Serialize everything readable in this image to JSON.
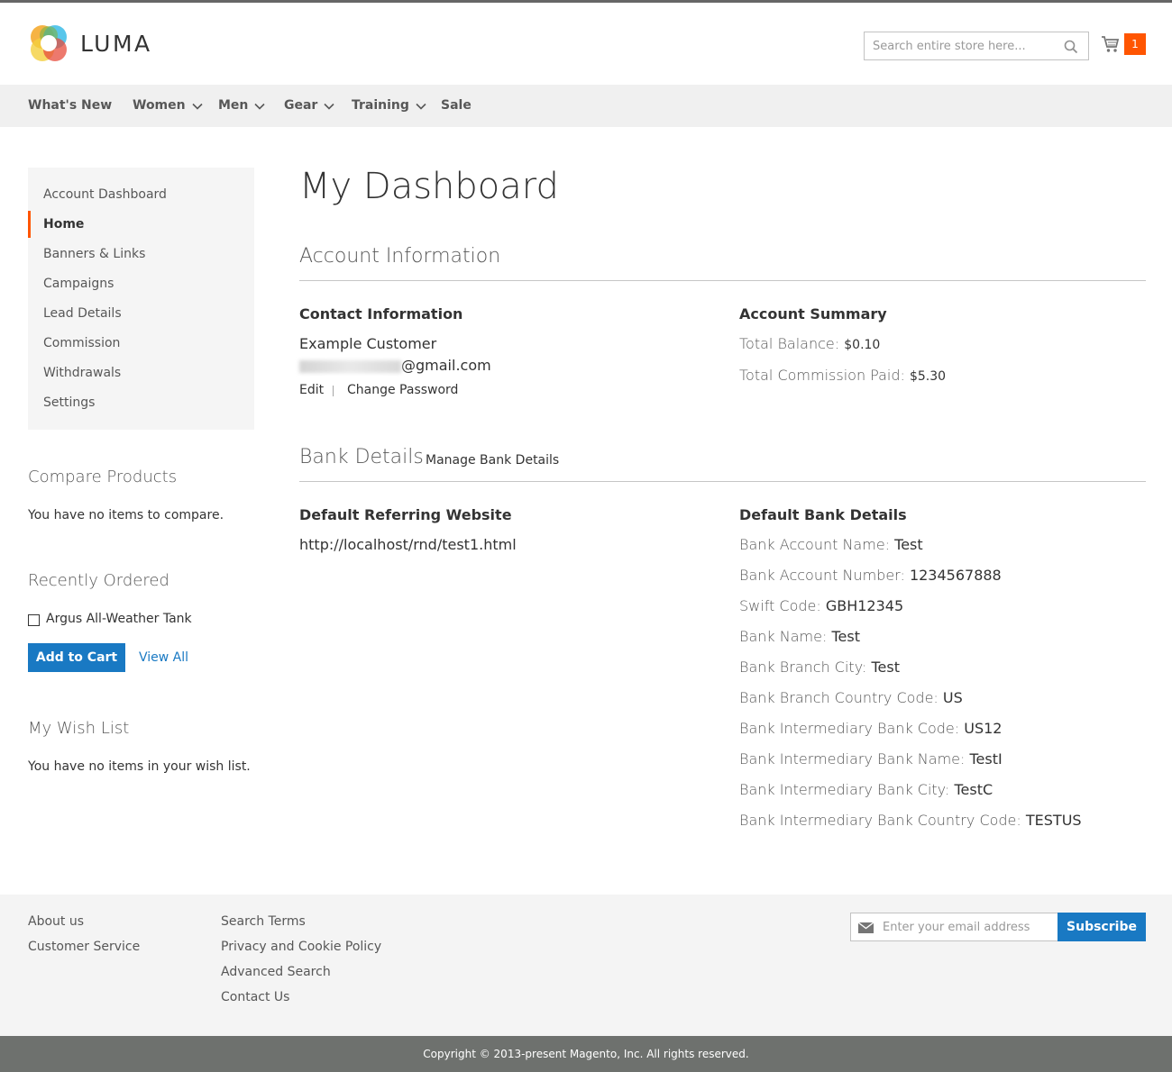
{
  "header": {
    "logo_text": "LUMA",
    "search_placeholder": "Search entire store here...",
    "cart_count": "1"
  },
  "nav": {
    "items": [
      {
        "label": "What's New",
        "dropdown": false
      },
      {
        "label": "Women",
        "dropdown": true
      },
      {
        "label": "Men",
        "dropdown": true
      },
      {
        "label": "Gear",
        "dropdown": true
      },
      {
        "label": "Training",
        "dropdown": true
      },
      {
        "label": "Sale",
        "dropdown": false
      }
    ]
  },
  "sidebar": {
    "items": [
      {
        "label": "Account Dashboard",
        "active": false
      },
      {
        "label": "Home",
        "active": true
      },
      {
        "label": "Banners & Links",
        "active": false
      },
      {
        "label": "Campaigns",
        "active": false
      },
      {
        "label": "Lead Details",
        "active": false
      },
      {
        "label": "Commission",
        "active": false
      },
      {
        "label": "Withdrawals",
        "active": false
      },
      {
        "label": "Settings",
        "active": false
      }
    ],
    "compare": {
      "title": "Compare Products",
      "empty_text": "You have no items to compare."
    },
    "recently_ordered": {
      "title": "Recently Ordered",
      "item": "Argus All-Weather Tank",
      "add_to_cart": "Add to Cart",
      "view_all": "View All"
    },
    "wishlist": {
      "title": "My Wish List",
      "empty_text": "You have no items in your wish list."
    }
  },
  "main": {
    "page_title": "My Dashboard",
    "account_info": {
      "title": "Account Information",
      "contact": {
        "title": "Contact Information",
        "name": "Example Customer",
        "email_suffix": "@gmail.com",
        "edit": "Edit",
        "change_password": "Change Password"
      },
      "summary": {
        "title": "Account Summary",
        "total_balance_label": "Total Balance:",
        "total_balance_value": "$0.10",
        "commission_paid_label": "Total Commission Paid:",
        "commission_paid_value": "$5.30"
      }
    },
    "bank": {
      "title": "Bank Details",
      "manage_link": "Manage Bank Details",
      "referring_title": "Default Referring Website",
      "referring_url": "http://localhost/rnd/test1.html",
      "details_title": "Default Bank Details",
      "fields": [
        {
          "label": "Bank Account Name:",
          "value": "Test"
        },
        {
          "label": "Bank Account Number:",
          "value": "1234567888"
        },
        {
          "label": "Swift Code:",
          "value": "GBH12345"
        },
        {
          "label": "Bank Name:",
          "value": "Test"
        },
        {
          "label": "Bank Branch City:",
          "value": "Test"
        },
        {
          "label": "Bank Branch Country Code:",
          "value": "US"
        },
        {
          "label": "Bank Intermediary Bank Code:",
          "value": "US12"
        },
        {
          "label": "Bank Intermediary Bank Name:",
          "value": "TestI"
        },
        {
          "label": "Bank Intermediary Bank City:",
          "value": "TestC"
        },
        {
          "label": "Bank Intermediary Bank Country Code:",
          "value": "TESTUS"
        }
      ]
    }
  },
  "footer": {
    "col1": [
      "About us",
      "Customer Service"
    ],
    "col2": [
      "Search Terms",
      "Privacy and Cookie Policy",
      "Advanced Search",
      "Contact Us"
    ],
    "newsletter_placeholder": "Enter your email address",
    "subscribe": "Subscribe",
    "copyright": "Copyright © 2013-present Magento, Inc. All rights reserved."
  },
  "colors": {
    "accent": "#1979c3",
    "brand_orange": "#ff5501"
  }
}
